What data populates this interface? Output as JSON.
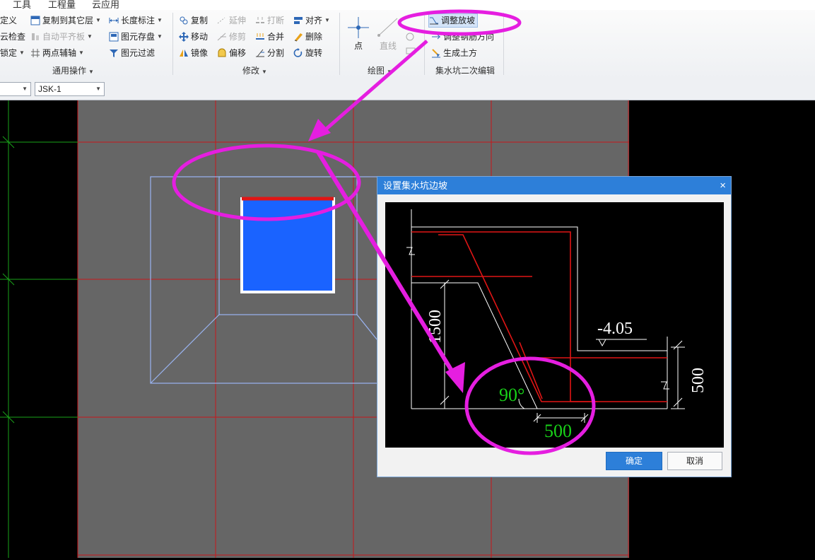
{
  "menubar": {
    "items": [
      "工具",
      "工程量",
      "云应用"
    ]
  },
  "ribbon": {
    "general": {
      "items": [
        {
          "label": "定义",
          "disabled": false
        },
        {
          "label": "云检查",
          "disabled": false
        },
        {
          "label": "锁定",
          "disabled": false
        },
        {
          "label": "复制到其它层",
          "disabled": false
        },
        {
          "label": "自动平齐板",
          "disabled": true
        },
        {
          "label": "两点辅轴",
          "disabled": false
        },
        {
          "label": "长度标注",
          "disabled": false
        },
        {
          "label": "图元存盘",
          "disabled": false
        },
        {
          "label": "图元过滤",
          "disabled": false
        }
      ],
      "group_label": "通用操作"
    },
    "modify": {
      "items": [
        {
          "label": "复制",
          "disabled": false
        },
        {
          "label": "移动",
          "disabled": false
        },
        {
          "label": "镜像",
          "disabled": false
        },
        {
          "label": "延伸",
          "disabled": true
        },
        {
          "label": "修剪",
          "disabled": true
        },
        {
          "label": "偏移",
          "disabled": false
        },
        {
          "label": "打断",
          "disabled": true
        },
        {
          "label": "合并",
          "disabled": false
        },
        {
          "label": "分割",
          "disabled": false
        },
        {
          "label": "对齐",
          "disabled": false
        },
        {
          "label": "删除",
          "disabled": false
        },
        {
          "label": "旋转",
          "disabled": false
        }
      ],
      "group_label": "修改"
    },
    "draw": {
      "items": [
        {
          "label": "点",
          "disabled": false
        },
        {
          "label": "直线",
          "disabled": true
        }
      ],
      "group_label": "绘图"
    },
    "pit": {
      "items": [
        {
          "label": "调整放坡",
          "disabled": false
        },
        {
          "label": "调整钢筋方向",
          "disabled": false
        },
        {
          "label": "生成土方",
          "disabled": false
        }
      ],
      "group_label": "集水坑二次编辑"
    }
  },
  "toolbar2": {
    "component_select": "JSK-1"
  },
  "dialog": {
    "title": "设置集水坑边坡",
    "close_glyph": "×",
    "ok_label": "确定",
    "cancel_label": "取消",
    "diagram": {
      "elevation_label": "-4.05",
      "height_label": "1500",
      "angle_label": "90°",
      "width_label": "500",
      "right_dim_label": "500"
    }
  },
  "colors": {
    "title_bar": "#2d7fd9",
    "annotation": "#e51ee0",
    "rebar": "#e01515",
    "pit_fill": "#1a63ff",
    "editable_text": "#19d219",
    "canvas_bg": "#666666",
    "grid_line": "#c8171b",
    "outline": "#9ab4f2"
  }
}
